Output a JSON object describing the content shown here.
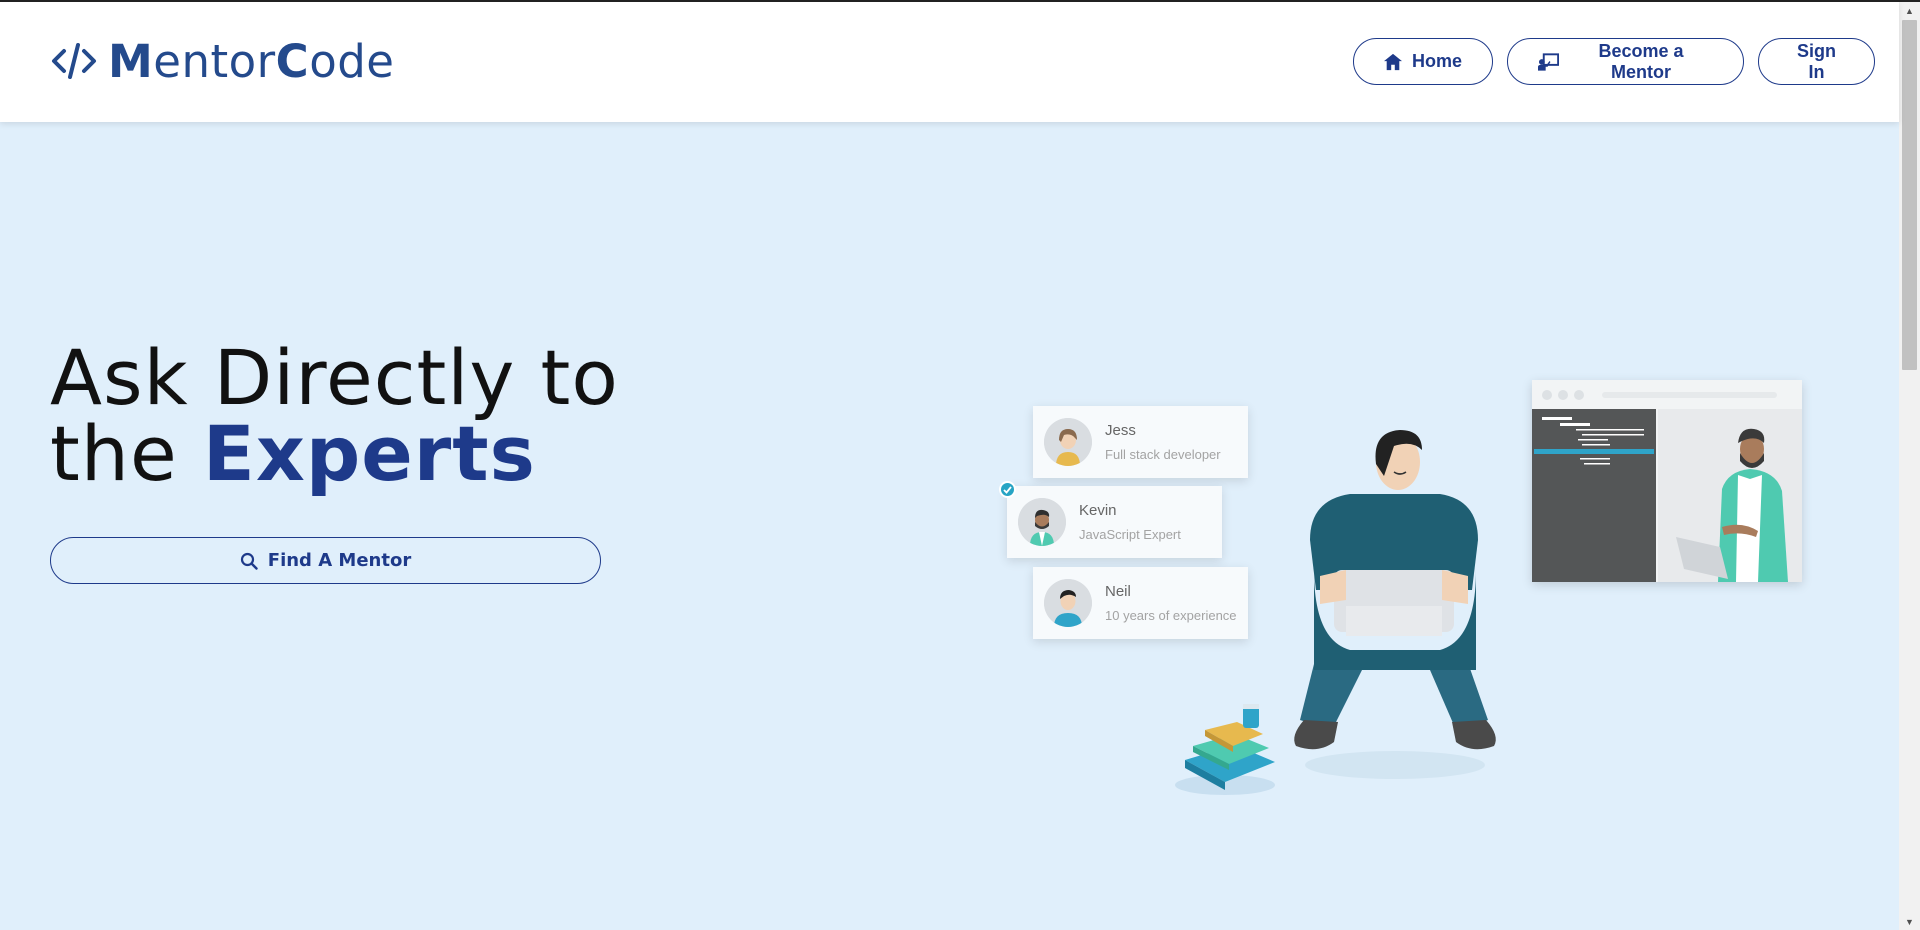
{
  "brand": {
    "name_part1": "M",
    "name_part2": "entor",
    "name_part3": "C",
    "name_part4": "ode",
    "color": "#244a8c"
  },
  "nav": {
    "home_label": "Home",
    "become_mentor_label": "Become a Mentor",
    "sign_in_label": "Sign In"
  },
  "hero": {
    "line1": "Ask Directly to",
    "line2_plain": "the",
    "line2_accent": "Experts",
    "find_mentor_label": "Find A Mentor"
  },
  "mentor_cards": [
    {
      "name": "Jess",
      "role": "Full stack developer"
    },
    {
      "name": "Kevin",
      "role": "JavaScript Expert",
      "verified": true
    },
    {
      "name": "Neil",
      "role": "10 years of experience"
    }
  ],
  "colors": {
    "accent": "#1e3a8a",
    "background": "#e0effb",
    "navbar": "#ffffff"
  },
  "icons": [
    "code-brackets-icon",
    "home-icon",
    "presentation-icon",
    "search-icon",
    "check-circle-icon"
  ]
}
